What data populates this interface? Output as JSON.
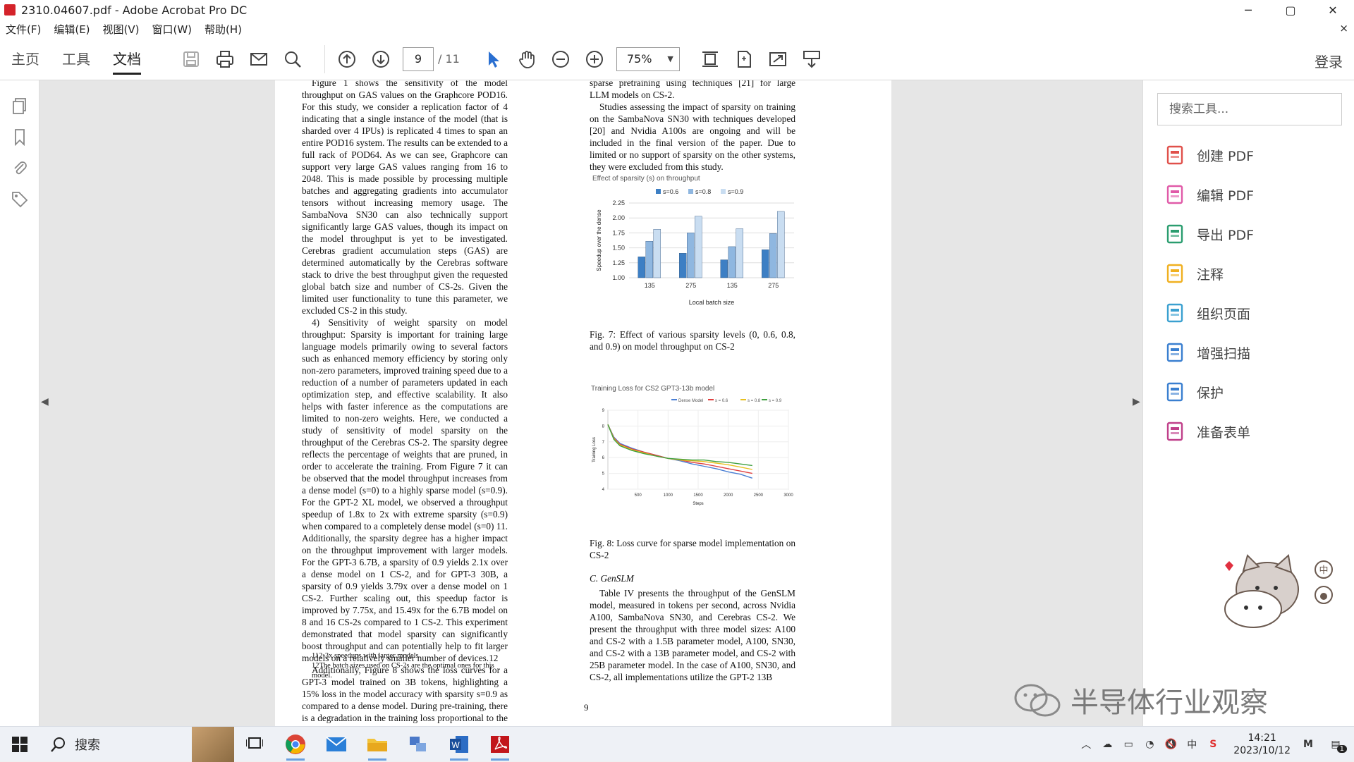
{
  "window": {
    "title": "2310.04607.pdf - Adobe Acrobat Pro DC",
    "minimize": "─",
    "maximize": "▢",
    "close": "✕"
  },
  "menu": {
    "items": [
      "文件(F)",
      "编辑(E)",
      "视图(V)",
      "窗口(W)",
      "帮助(H)"
    ],
    "close_doc": "×"
  },
  "toolbar": {
    "tabs": [
      "主页",
      "工具",
      "文档"
    ],
    "active_tab": "文档",
    "page_current": "9",
    "page_total": "/ 11",
    "zoom": "75%",
    "signin": "登录"
  },
  "document": {
    "left_col": [
      {
        "type": "p",
        "text": "Figure 1 shows the sensitivity of the model throughput on GAS values on the Graphcore POD16. For this study, we consider a replication factor of 4 indicating that a single instance of the model (that is sharded over 4 IPUs) is replicated 4 times to span an entire POD16 system. The results can be extended to a full rack of POD64. As we can see, Graphcore can support very large GAS values ranging from 16 to 2048. This is made possible by processing multiple batches and aggregating gradients into accumulator tensors without increasing memory usage. The SambaNova SN30 can also technically support significantly large GAS values, though its impact on the model throughput is yet to be investigated. Cerebras gradient accumulation steps (GAS) are determined automatically by the Cerebras software stack to drive the best throughput given the requested global batch size and number of CS-2s. Given the limited user functionality to tune this parameter, we excluded CS-2 in this study."
      },
      {
        "type": "p",
        "text": "4) Sensitivity of weight sparsity on model throughput: Sparsity is important for training large language models primarily owing to several factors such as enhanced memory efficiency by storing only non-zero parameters, improved training speed due to a reduction of a number of parameters updated in each optimization step, and effective scalability. It also helps with faster inference as the computations are limited to non-zero weights. Here, we conducted a study of sensitivity of model sparsity on the throughput of the Cerebras CS-2. The sparsity degree reflects the percentage of weights that are pruned, in order to accelerate the training. From Figure 7 it can be observed that the model throughput increases from a dense model (s=0) to a highly sparse model (s=0.9). For the GPT-2 XL model, we observed a throughput speedup of 1.8x to 2x with extreme sparsity (s=0.9) when compared to a completely dense model (s=0) 11. Additionally, the sparsity degree has a higher impact on the throughput improvement with larger models. For the GPT-3 6.7B, a sparsity of 0.9 yields 2.1x over a dense model on 1 CS-2, and for GPT-3 30B, a sparsity of 0.9 yields 3.79x over a dense model on 1 CS-2. Further scaling out, this speedup factor is improved by 7.75x, and 15.49x for the 6.7B model on 8 and 16 CS-2s compared to 1 CS-2. This experiment demonstrated that model sparsity can significantly boost throughput and can potentially help to fit larger models on a relatively smaller number of devices.12"
      },
      {
        "type": "p",
        "text": "Additionally, Figure 8 shows the loss curves for a GPT-3 model trained on 3B tokens, highlighting a 15% loss in the model accuracy with sparsity s=0.9 as compared to a dense model. During pre-training, there is a degradation in the training loss proportional to the sparsity value. However,"
      }
    ],
    "footnotes": [
      "112-3x speedups with larger models",
      "12The batch sizes used on CS-2s are the optimal ones for this model."
    ],
    "right_col_top": [
      {
        "type": "p",
        "text": "sparse pretraining using techniques [21] for large LLM models on CS-2."
      },
      {
        "type": "p",
        "text": "Studies assessing the impact of sparsity on training on the SambaNova SN30 with techniques developed [20] and Nvidia A100s are ongoing and will be included in the final version of the paper. Due to limited or no support of sparsity on the other systems, they were excluded from this study."
      }
    ],
    "fig7_caption": "Fig. 7: Effect of various sparsity levels (0, 0.6, 0.8, and 0.9) on model throughput on CS-2",
    "fig8_caption": "Fig. 8: Loss curve for sparse model implementation on CS-2",
    "section_heading": "C. GenSLM",
    "right_col_bottom": "Table IV presents the throughput of the GenSLM model, measured in tokens per second, across Nvidia A100, SambaNova SN30, and Cerebras CS-2. We present the throughput with three model sizes: A100 and CS-2 with a 1.5B parameter model, A100, SN30, and CS-2 with a 13B parameter model, and CS-2 with 25B parameter model. In the case of A100, SN30, and CS-2, all implementations utilize the GPT-2 13B",
    "page_number": "9"
  },
  "right_pane": {
    "search_placeholder": "搜索工具...",
    "tools": [
      {
        "label": "创建 PDF",
        "icon": "create-pdf-icon",
        "color": "#e0504a"
      },
      {
        "label": "编辑 PDF",
        "icon": "edit-pdf-icon",
        "color": "#e05aa8"
      },
      {
        "label": "导出 PDF",
        "icon": "export-pdf-icon",
        "color": "#2a9d6f"
      },
      {
        "label": "注释",
        "icon": "comment-icon",
        "color": "#f0b020"
      },
      {
        "label": "组织页面",
        "icon": "organize-pages-icon",
        "color": "#3aa0d0"
      },
      {
        "label": "增强扫描",
        "icon": "enhance-scan-icon",
        "color": "#3a7fd0"
      },
      {
        "label": "保护",
        "icon": "protect-icon",
        "color": "#3a7fd0"
      },
      {
        "label": "准备表单",
        "icon": "prepare-form-icon",
        "color": "#c0408a"
      }
    ],
    "watermark": "半导体行业观察",
    "ime_label": "中"
  },
  "taskbar": {
    "search_label": "搜索",
    "time": "14:21",
    "date": "2023/10/12",
    "ime": "中",
    "notification_count": "1"
  },
  "chart_data": [
    {
      "type": "bar",
      "title": "Effect of sparsity (s) on throughput",
      "xlabel": "Local batch size",
      "ylabel": "Speedup over the dense",
      "categories": [
        "135",
        "275",
        "135",
        "275"
      ],
      "ylim": [
        1.0,
        2.25
      ],
      "yticks": [
        "1.00",
        "1.25",
        "1.50",
        "1.75",
        "2.00",
        "2.25"
      ],
      "legend": "top",
      "series": [
        {
          "name": "s=0.6",
          "color": "#3d7fc4",
          "values": [
            1.35,
            1.41,
            1.3,
            1.47
          ]
        },
        {
          "name": "s=0.8",
          "color": "#8fb7e0",
          "values": [
            1.61,
            1.75,
            1.52,
            1.74
          ]
        },
        {
          "name": "s=0.9",
          "color": "#c9ddf1",
          "values": [
            1.81,
            2.03,
            1.82,
            2.11
          ]
        }
      ]
    },
    {
      "type": "line",
      "title": "Training Loss for CS2 GPT3-13b model",
      "xlabel": "Steps",
      "ylabel": "Training Loss",
      "xlim": [
        0,
        3000
      ],
      "ylim": [
        4,
        9
      ],
      "xticks": [
        "500",
        "1000",
        "1500",
        "2000",
        "2500",
        "3000"
      ],
      "yticks": [
        "4",
        "5",
        "6",
        "7",
        "8",
        "9"
      ],
      "legend": "top",
      "series": [
        {
          "name": "Dense Model",
          "color": "#4a7fd4",
          "x": [
            0,
            100,
            200,
            400,
            600,
            800,
            1000,
            1200,
            1400,
            1600,
            1800,
            2000,
            2200,
            2400
          ],
          "y": [
            8.1,
            7.3,
            6.9,
            6.6,
            6.35,
            6.15,
            5.95,
            5.8,
            5.6,
            5.45,
            5.3,
            5.1,
            4.95,
            4.7
          ]
        },
        {
          "name": "s = 0.6",
          "color": "#e04040",
          "x": [
            0,
            100,
            200,
            400,
            600,
            800,
            1000,
            1200,
            1400,
            1600,
            1800,
            2000,
            2200,
            2400
          ],
          "y": [
            8.1,
            7.25,
            6.85,
            6.55,
            6.35,
            6.15,
            5.95,
            5.85,
            5.7,
            5.6,
            5.45,
            5.3,
            5.15,
            5.0
          ]
        },
        {
          "name": "s = 0.8",
          "color": "#e8c020",
          "x": [
            0,
            100,
            200,
            400,
            600,
            800,
            1000,
            1200,
            1400,
            1600,
            1800,
            2000,
            2200,
            2400
          ],
          "y": [
            8.1,
            7.2,
            6.8,
            6.5,
            6.3,
            6.1,
            5.95,
            5.85,
            5.8,
            5.75,
            5.65,
            5.55,
            5.4,
            5.25
          ]
        },
        {
          "name": "s = 0.9",
          "color": "#40a040",
          "x": [
            0,
            100,
            200,
            400,
            600,
            800,
            1000,
            1200,
            1400,
            1600,
            1800,
            2000,
            2200,
            2400
          ],
          "y": [
            8.1,
            7.15,
            6.75,
            6.45,
            6.25,
            6.1,
            5.95,
            5.9,
            5.85,
            5.85,
            5.75,
            5.7,
            5.6,
            5.5
          ]
        }
      ]
    }
  ]
}
